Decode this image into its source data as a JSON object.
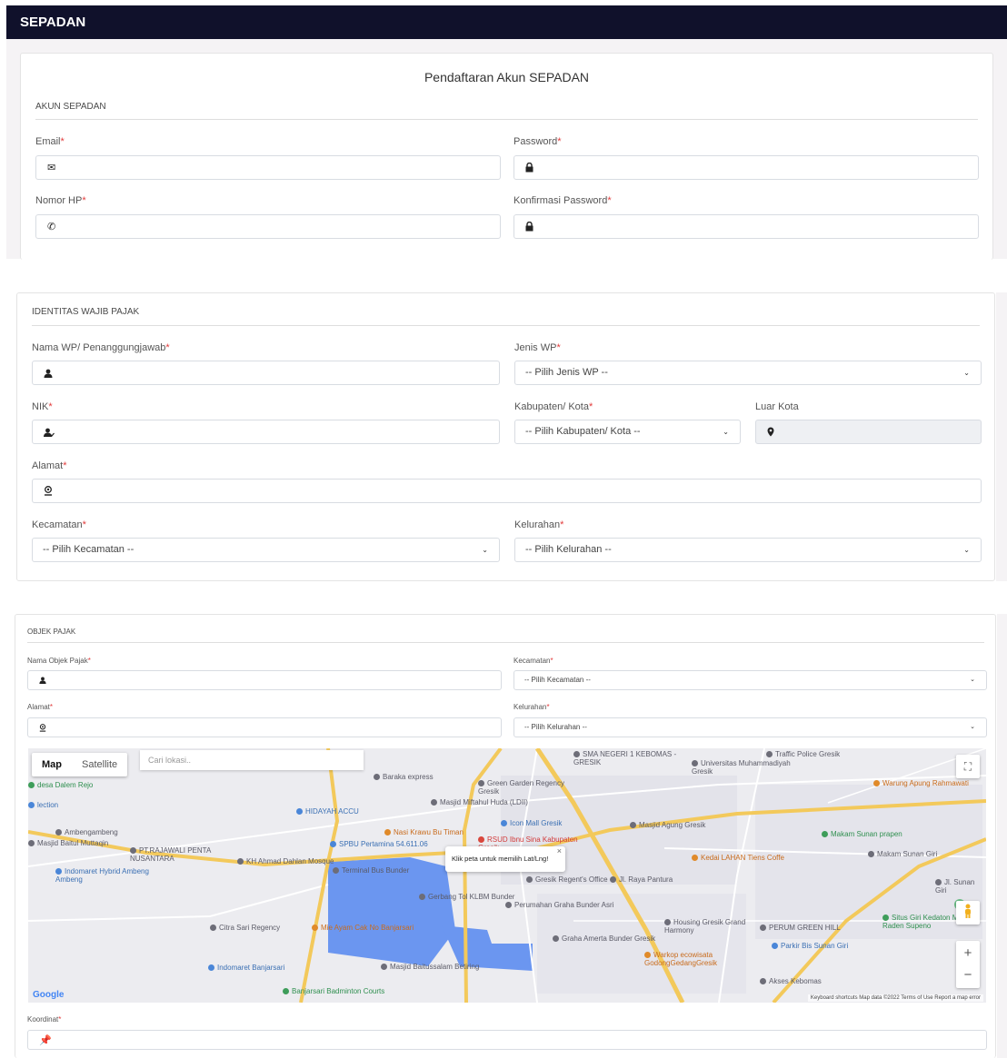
{
  "app": {
    "brand": "SEPADAN"
  },
  "page": {
    "title": "Pendaftaran Akun SEPADAN"
  },
  "akun": {
    "section_title": "AKUN SEPADAN",
    "email_label": "Email",
    "password_label": "Password",
    "phone_label": "Nomor HP",
    "confirm_label": "Konfirmasi Password",
    "required_mark": "*"
  },
  "identitas": {
    "section_title": "IDENTITAS WAJIB PAJAK",
    "nama_label": "Nama WP/ Penanggungjawab",
    "jenis_label": "Jenis WP",
    "jenis_value": "-- Pilih Jenis WP --",
    "nik_label": "NIK",
    "kab_label": "Kabupaten/ Kota",
    "kab_value": "-- Pilih Kabupaten/ Kota --",
    "luar_label": "Luar Kota",
    "alamat_label": "Alamat",
    "kec_label": "Kecamatan",
    "kec_value": "-- Pilih Kecamatan --",
    "kel_label": "Kelurahan",
    "kel_value": "-- Pilih Kelurahan --"
  },
  "objek": {
    "section_title": "OBJEK PAJAK",
    "nama_label": "Nama Objek Pajak",
    "kec_label": "Kecamatan",
    "kec_value": "-- Pilih Kecamatan --",
    "alamat_label": "Alamat",
    "kel_label": "Kelurahan",
    "kel_value": "-- Pilih Kelurahan --",
    "koordinat_label": "Koordinat"
  },
  "map": {
    "type_map": "Map",
    "type_satellite": "Satellite",
    "search_placeholder": "Cari lokasi..",
    "tooltip": "Klik peta untuk memilih Lat/Lng!",
    "google": "Google",
    "footer": "Keyboard shortcuts   Map data ©2022   Terms of Use   Report a map error",
    "zoom_in": "+",
    "zoom_out": "−",
    "places": [
      {
        "name": "SMA NEGERI 1 KEBOMAS - GRESIK",
        "style": ""
      },
      {
        "name": "Traffic Police Gresik",
        "style": ""
      },
      {
        "name": "Universitas Muhammadiyah Gresik",
        "style": ""
      },
      {
        "name": "Baraka express",
        "style": ""
      },
      {
        "name": "Green Garden Regency Gresik",
        "style": ""
      },
      {
        "name": "Warung Apung Rahmawati",
        "style": "o"
      },
      {
        "name": "desa Dalem Rejo",
        "style": "g"
      },
      {
        "name": "lection",
        "style": "b"
      },
      {
        "name": "HIDAYAH ACCU",
        "style": "b"
      },
      {
        "name": "Masjid Miftahul Huda (LDII)",
        "style": ""
      },
      {
        "name": "Icon Mall Gresik",
        "style": "b"
      },
      {
        "name": "Masjid Agung Gresik",
        "style": ""
      },
      {
        "name": "Ambengambeng",
        "style": ""
      },
      {
        "name": "Masjid Baitul Muttaqin",
        "style": ""
      },
      {
        "name": "Nasi Krawu Bu Timan",
        "style": "o"
      },
      {
        "name": "RSUD Ibnu Sina Kabupaten Gresik",
        "style": "r"
      },
      {
        "name": "Makam Sunan prapen",
        "style": "g"
      },
      {
        "name": "SPBU Pertamina 54.611.06",
        "style": "b"
      },
      {
        "name": "PT.RAJAWALI PENTA NUSANTARA",
        "style": ""
      },
      {
        "name": "KH Ahmad Dahlan Mosque",
        "style": ""
      },
      {
        "name": "Terminal Bus Bunder",
        "style": ""
      },
      {
        "name": "Kedai LAHAN Tiens Coffe",
        "style": "o"
      },
      {
        "name": "Makam Sunan Giri",
        "style": ""
      },
      {
        "name": "Indomaret Hybrid Ambeng Ambeng",
        "style": "b"
      },
      {
        "name": "Gresik Regent's Office",
        "style": ""
      },
      {
        "name": "Gerbang Tol KLBM Bunder",
        "style": ""
      },
      {
        "name": "Perumahan Graha Bunder Asri",
        "style": ""
      },
      {
        "name": "Situs Giri Kedaton Makam Raden Supeno",
        "style": "g"
      },
      {
        "name": "Citra Sari Regency",
        "style": ""
      },
      {
        "name": "Mie Ayam Cak No Banjarsari",
        "style": "o"
      },
      {
        "name": "Housing Gresik Grand Harmony",
        "style": ""
      },
      {
        "name": "PERUM GREEN HILL",
        "style": ""
      },
      {
        "name": "Parkir Bis Sunan Giri",
        "style": "b"
      },
      {
        "name": "Indomaret Banjarsari",
        "style": "b"
      },
      {
        "name": "Masjid Baitussalam Betiring",
        "style": ""
      },
      {
        "name": "Graha Amerta Bunder Gresik",
        "style": ""
      },
      {
        "name": "Warkop ecowisata GodongGedangGresik",
        "style": "o"
      },
      {
        "name": "Akses Kebomas",
        "style": ""
      },
      {
        "name": "Banjarsari Badminton Courts",
        "style": "g"
      },
      {
        "name": "Jl. Raya Pantura",
        "style": ""
      },
      {
        "name": "Jl. Sunan Giri",
        "style": ""
      }
    ]
  }
}
